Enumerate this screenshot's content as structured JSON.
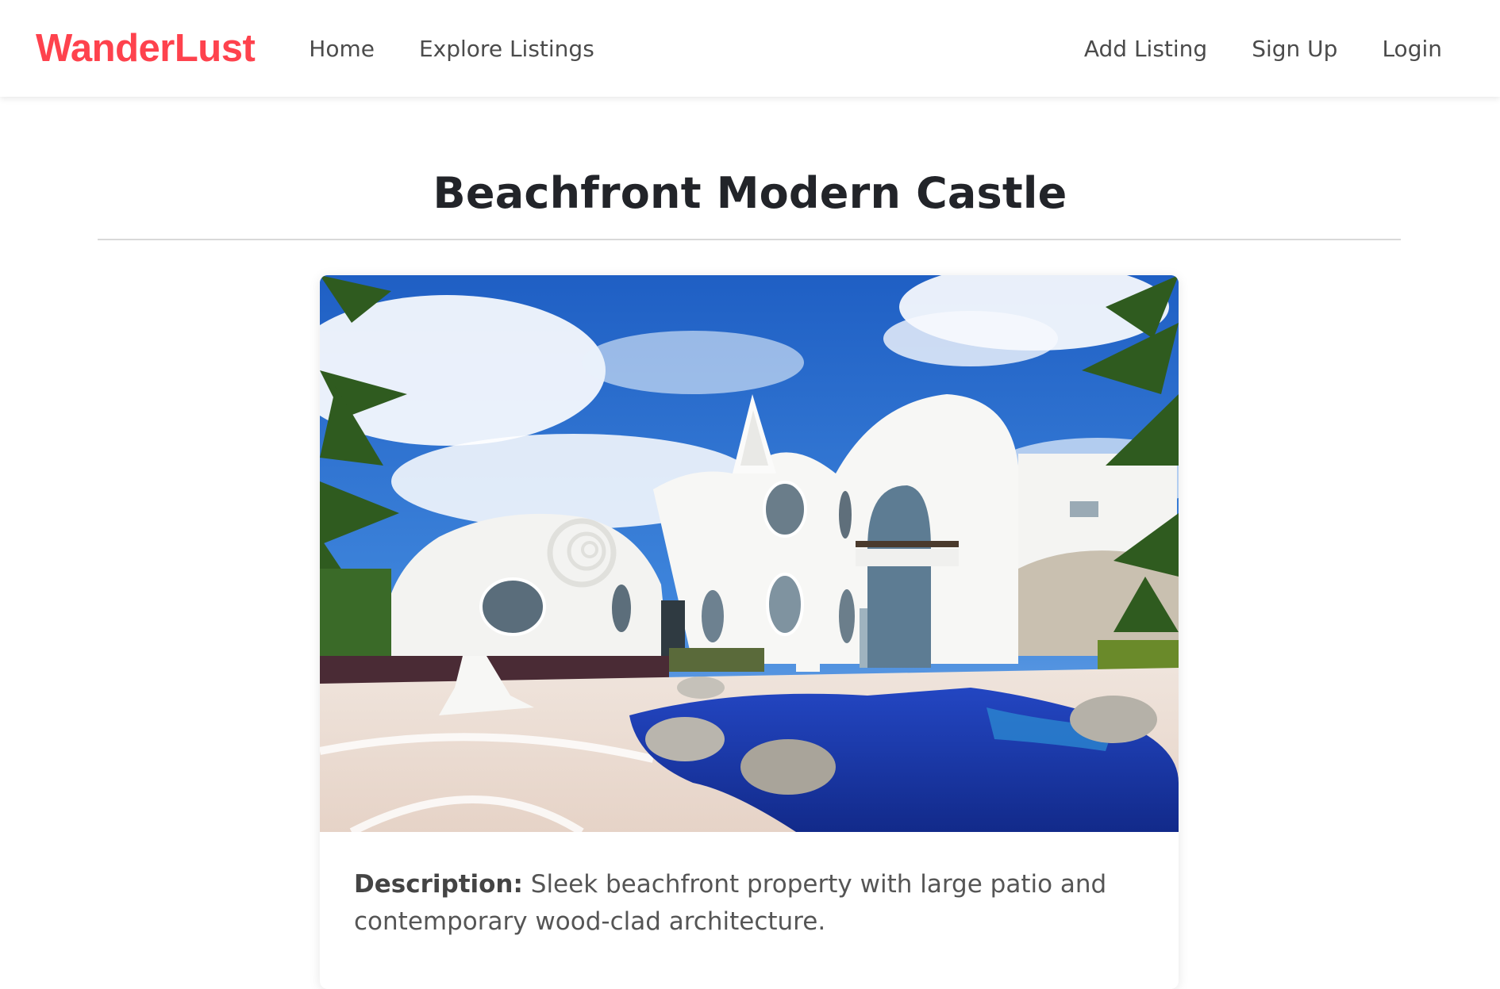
{
  "navbar": {
    "brand": "WanderLust",
    "brand_color": "#fe424d",
    "links": [
      {
        "label": "Home"
      },
      {
        "label": "Explore Listings"
      }
    ],
    "right_links": [
      {
        "label": "Add Listing"
      },
      {
        "label": "Sign Up"
      },
      {
        "label": "Login"
      }
    ]
  },
  "listing": {
    "title": "Beachfront Modern Castle",
    "description_label": "Description:",
    "description": "Sleek beachfront property with large patio and contemporary wood-clad architecture."
  },
  "colors": {
    "text_dark": "#222429",
    "nav_text": "#4b4b4b",
    "divider": "#d9d9d9"
  }
}
